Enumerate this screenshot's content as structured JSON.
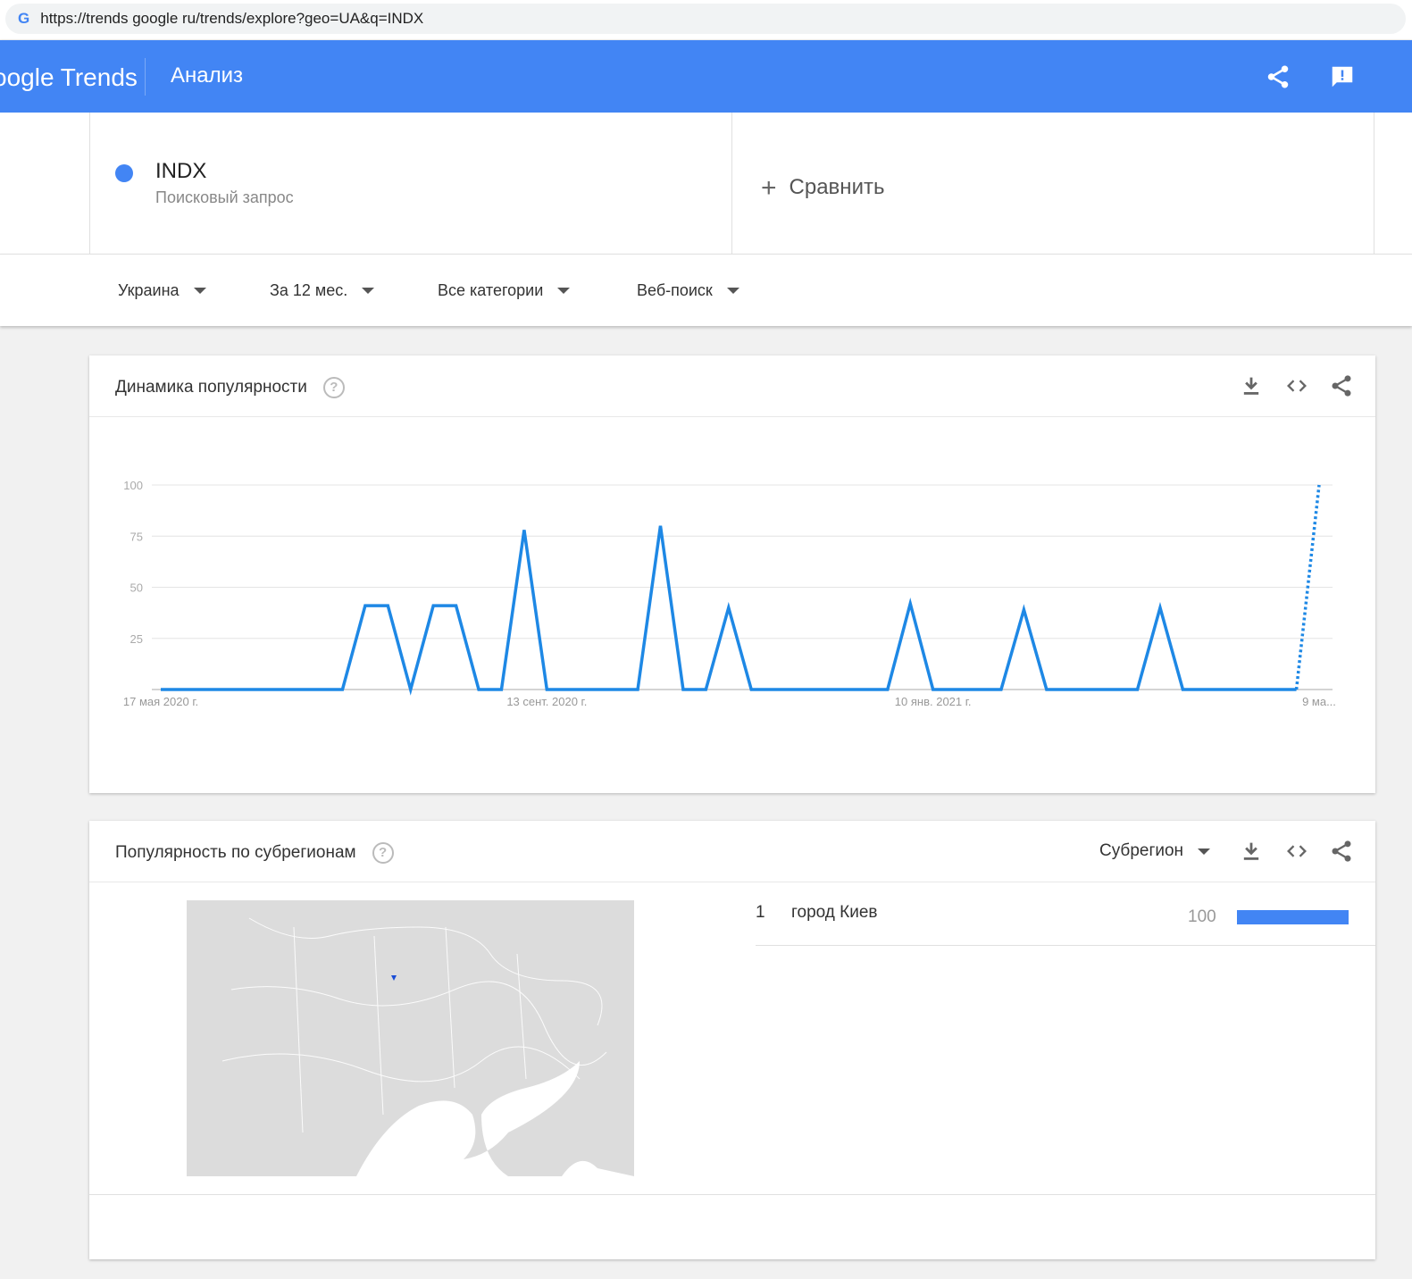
{
  "browser": {
    "url": "https://trends google ru/trends/explore?geo=UA&q=INDX",
    "favicon": "G"
  },
  "header": {
    "logo": "oogle Trends",
    "title": "Анализ",
    "icons": [
      "share-icon",
      "feedback-icon"
    ]
  },
  "term": {
    "name": "INDX",
    "type": "Поисковый запрос",
    "color": "#4285f4"
  },
  "compare": {
    "label": "Сравнить"
  },
  "filters": [
    {
      "label": "Украина"
    },
    {
      "label": "За 12 мес."
    },
    {
      "label": "Все категории"
    },
    {
      "label": "Веб-поиск"
    }
  ],
  "interest": {
    "title": "Динамика популярности",
    "help": "?"
  },
  "chart_data": {
    "type": "line",
    "title": "Динамика популярности",
    "yticks": [
      "100",
      "75",
      "50",
      "25"
    ],
    "ylim": [
      0,
      100
    ],
    "xticks": [
      {
        "label": "17 мая 2020 г.",
        "index": 0
      },
      {
        "label": "13 сент. 2020 г.",
        "index": 17
      },
      {
        "label": "10 янв. 2021 г.",
        "index": 34
      },
      {
        "label": "9 ма...",
        "index": 51
      }
    ],
    "grid": true,
    "color": "#1e88e5",
    "series": [
      {
        "name": "INDX",
        "values": [
          0,
          0,
          0,
          0,
          0,
          0,
          0,
          0,
          0,
          41,
          41,
          0,
          41,
          41,
          0,
          0,
          78,
          0,
          0,
          0,
          0,
          0,
          80,
          0,
          0,
          40,
          0,
          0,
          0,
          0,
          0,
          0,
          0,
          42,
          0,
          0,
          0,
          0,
          39,
          0,
          0,
          0,
          0,
          0,
          40,
          0,
          0,
          0,
          0,
          0,
          0,
          100
        ],
        "partial_last": true
      }
    ]
  },
  "region": {
    "title": "Популярность по субрегионам",
    "help": "?",
    "dropdown": "Субрегион",
    "rows": [
      {
        "rank": "1",
        "name": "город Киев",
        "value": "100",
        "fraction": 1.0
      }
    ]
  }
}
